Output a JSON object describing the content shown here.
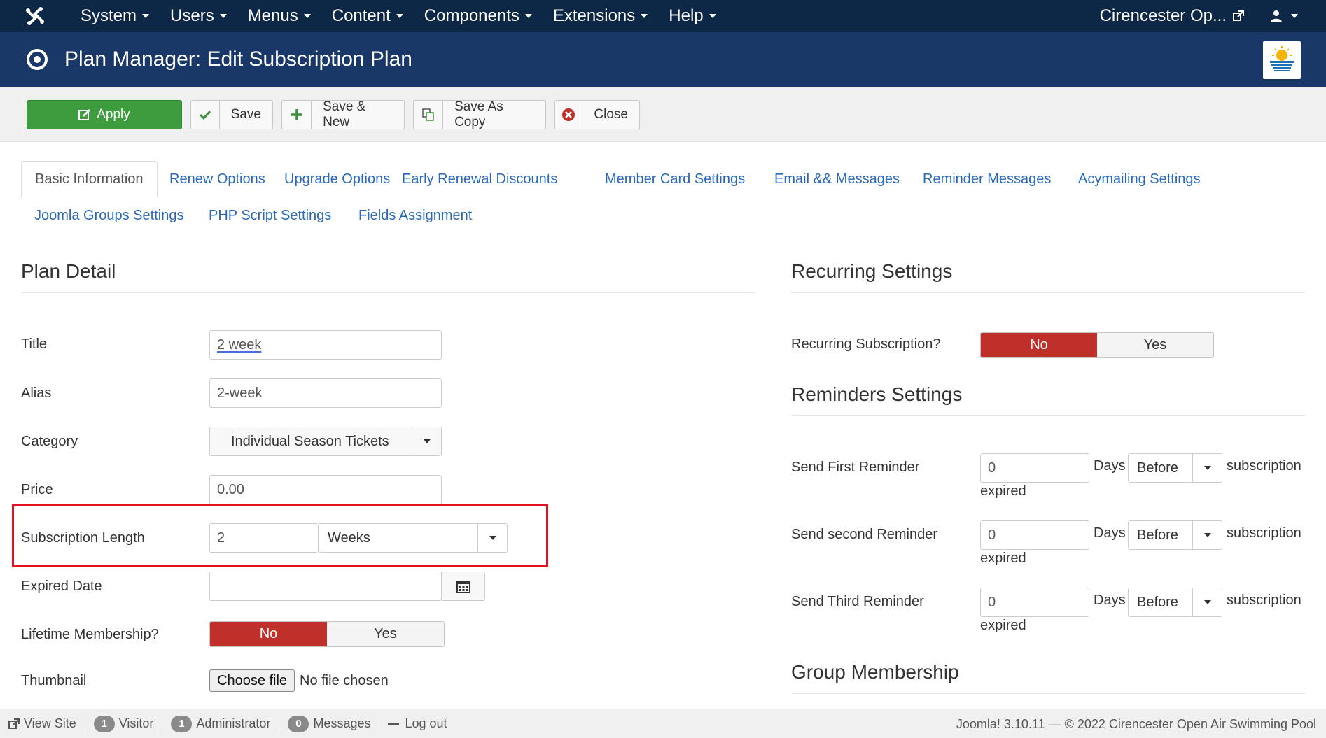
{
  "topbar": {
    "menu": [
      "System",
      "Users",
      "Menus",
      "Content",
      "Components",
      "Extensions",
      "Help"
    ],
    "site_name": "Cirencester Op...",
    "icons": {
      "logo": "joomla-logo",
      "external": "external-link-icon",
      "user": "user-icon"
    }
  },
  "header": {
    "title": "Plan Manager: Edit Subscription Plan"
  },
  "toolbar": {
    "apply": "Apply",
    "save": "Save",
    "save_new": "Save & New",
    "save_copy": "Save As Copy",
    "close": "Close"
  },
  "tabs": [
    "Basic Information",
    "Renew Options",
    "Upgrade Options",
    "Early Renewal Discounts",
    "Member Card Settings",
    "Email && Messages",
    "Reminder Messages",
    "Acymailing Settings",
    "Joomla Groups Settings",
    "PHP Script Settings",
    "Fields Assignment"
  ],
  "plan": {
    "heading": "Plan Detail",
    "title_label": "Title",
    "title_value": "2 week",
    "alias_label": "Alias",
    "alias_value": "2-week",
    "category_label": "Category",
    "category_value": "Individual Season Tickets",
    "price_label": "Price",
    "price_value": "0.00",
    "length_label": "Subscription Length",
    "length_value": "2",
    "length_unit": "Weeks",
    "expired_label": "Expired Date",
    "expired_value": "",
    "lifetime_label": "Lifetime Membership?",
    "no": "No",
    "yes": "Yes",
    "thumbnail_label": "Thumbnail",
    "choose_file": "Choose file",
    "no_file": "No file chosen"
  },
  "recurring": {
    "heading": "Recurring Settings",
    "label": "Recurring Subscription?",
    "no": "No",
    "yes": "Yes"
  },
  "reminders": {
    "heading": "Reminders Settings",
    "days": "Days",
    "before": "Before",
    "subscription": "subscription",
    "expired": "expired",
    "items": [
      {
        "label": "Send First Reminder",
        "value": "0"
      },
      {
        "label": "Send second Reminder",
        "value": "0"
      },
      {
        "label": "Send Third Reminder",
        "value": "0"
      }
    ]
  },
  "group": {
    "heading": "Group Membership"
  },
  "footer": {
    "view_site": "View Site",
    "visitor_count": "1",
    "visitor": "Visitor",
    "admin_count": "1",
    "admin": "Administrator",
    "messages_count": "0",
    "messages": "Messages",
    "logout": "Log out",
    "copyright": "Joomla! 3.10.11 — © 2022 Cirencester Open Air Swimming Pool"
  }
}
